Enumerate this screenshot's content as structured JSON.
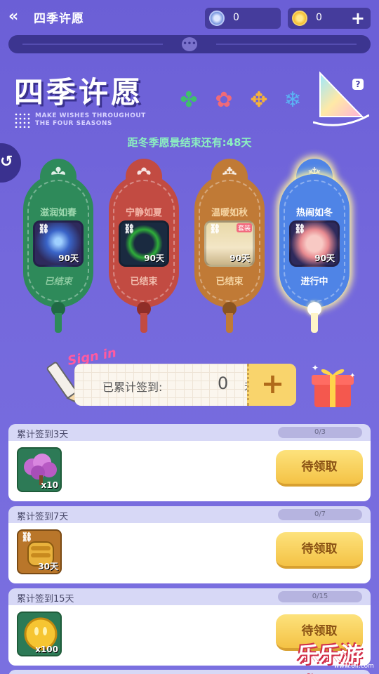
{
  "header": {
    "title": "四季许愿",
    "back_icon": "double-chevron-left-icon"
  },
  "currency": [
    {
      "icon": "diamond-coin-icon",
      "value": "0"
    },
    {
      "icon": "gold-coin-icon",
      "value": "0"
    }
  ],
  "banner": {
    "title": "四季许愿",
    "subtitle_line1": "MAKE WISHES THROUGHOUT",
    "subtitle_line2": "THE FOUR SEASONS",
    "help": "?",
    "countdown": "距冬季愿景结束还有:48天"
  },
  "seasons": [
    {
      "name": "滋润如春",
      "days": "90天",
      "status": "已结束",
      "emblem": "clover-icon"
    },
    {
      "name": "宁静如夏",
      "days": "90天",
      "status": "已结束",
      "emblem": "sun-flower-icon"
    },
    {
      "name": "温暖如秋",
      "days": "90天",
      "status": "已结束",
      "emblem": "maple-icon",
      "badge": "套装"
    },
    {
      "name": "热闹如冬",
      "days": "90天",
      "status": "进行中",
      "emblem": "snowflake-icon"
    }
  ],
  "signin": {
    "deco": "Sign in",
    "label": "已累计签到:",
    "count": "0",
    "unit": "天",
    "plus": "+"
  },
  "tasks": [
    {
      "title": "累计签到3天",
      "progress": "0/3",
      "qty": "x10",
      "button": "待领取"
    },
    {
      "title": "累计签到7天",
      "progress": "0/7",
      "qty": "30天",
      "button": "待领取"
    },
    {
      "title": "累计签到15天",
      "progress": "0/15",
      "qty": "x100",
      "button": "待领取"
    }
  ],
  "watermark": {
    "main": "乐乐游戏",
    "sub": "www.6ll.com"
  },
  "colors": {
    "bg": "#6b5fd6",
    "spring": "#2e8a5a",
    "summer": "#c24b42",
    "autumn": "#c07a36",
    "winter": "#4f84e6",
    "claim": "#f4c245"
  }
}
